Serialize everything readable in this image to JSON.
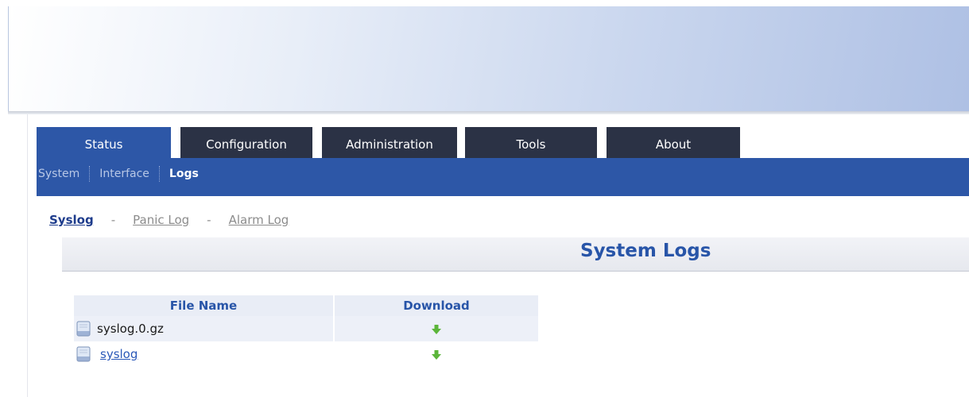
{
  "tabs": [
    {
      "label": "Status",
      "active": true
    },
    {
      "label": "Configuration",
      "active": false
    },
    {
      "label": "Administration",
      "active": false
    },
    {
      "label": "Tools",
      "active": false
    },
    {
      "label": "About",
      "active": false
    }
  ],
  "subnav": [
    {
      "label": "System",
      "active": false
    },
    {
      "label": "Interface",
      "active": false
    },
    {
      "label": "Logs",
      "active": true
    }
  ],
  "log_links": [
    {
      "label": "Syslog",
      "active": true
    },
    {
      "label": "Panic Log",
      "active": false
    },
    {
      "label": "Alarm Log",
      "active": false
    }
  ],
  "log_link_separator": "-",
  "section_title": "System Logs",
  "table": {
    "headers": {
      "file_name": "File Name",
      "download": "Download"
    },
    "rows": [
      {
        "file_name": "syslog.0.gz",
        "is_link": false
      },
      {
        "file_name": "syslog",
        "is_link": true
      }
    ]
  },
  "icons": {
    "file": "document-icon",
    "download": "green-down-arrow-icon"
  },
  "colors": {
    "nav_active": "#2d57a7",
    "nav_inactive": "#2b3245",
    "title_blue": "#2855a8",
    "download_green": "#5bb53a"
  }
}
